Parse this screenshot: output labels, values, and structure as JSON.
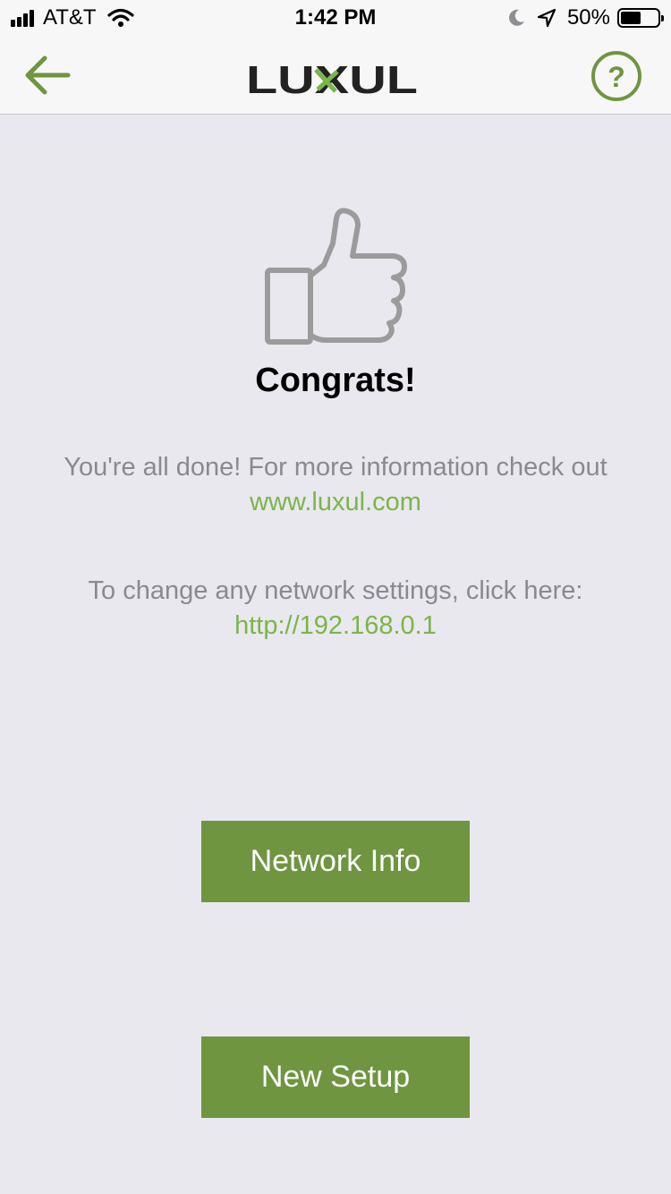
{
  "status_bar": {
    "carrier": "AT&T",
    "time": "1:42 PM",
    "battery": "50%",
    "icons": [
      "signal-icon",
      "wifi-icon",
      "moon-icon",
      "location-arrow-icon",
      "battery-icon"
    ]
  },
  "nav": {
    "logo_text": "LUXUL",
    "icons": [
      "back-arrow-icon",
      "help-icon"
    ]
  },
  "main": {
    "icon": "thumbs-up-icon",
    "title": "Congrats!",
    "message1_text": "You're all done! For more information check out ",
    "message1_link": "www.luxul.com",
    "message2_text": "To change any network settings, click here: ",
    "message2_link": "http://192.168.0.1"
  },
  "buttons": {
    "network_info": "Network Info",
    "new_setup": "New Setup"
  },
  "colors": {
    "accent": "#6f9540",
    "link": "#7ab54a",
    "background": "#e9e8ee",
    "body_text": "#8a8a8e"
  }
}
